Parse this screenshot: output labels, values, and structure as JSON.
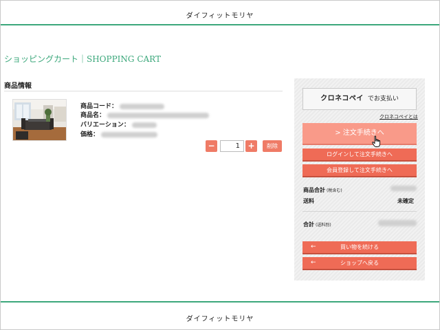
{
  "header": {
    "shop_name": "ダイフィットモリヤ"
  },
  "page_title": "ショッピングカート｜SHOPPING CART",
  "product_section": {
    "heading": "商品情報",
    "item": {
      "code_label": "商品コード：",
      "name_label": "商品名：",
      "variation_label": "バリエーション：",
      "price_label": "価格：",
      "quantity": "1",
      "minus_label": "−",
      "plus_label": "+",
      "delete_label": "削除"
    }
  },
  "sidebar": {
    "kuroneko_pay_brand": "クロネコペイ",
    "kuroneko_pay_suffix": "でお支払い",
    "kuroneko_link": "クロネコペイとは",
    "checkout_button": "> 注文手続きへ",
    "login_checkout_button": "ログインして注文手続きへ",
    "register_checkout_button": "会員登録して注文手続きへ",
    "subtotal_label": "商品合計",
    "subtotal_note": "(税含む)",
    "shipping_label": "送料",
    "shipping_value": "未確定",
    "total_label": "合計",
    "total_note": "(送料別)",
    "continue_shopping_button": "買い物を続ける",
    "back_to_shop_button": "ショップへ戻る",
    "arrow_glyph": "←"
  },
  "footer": {
    "shop_name": "ダイフィットモリヤ"
  },
  "colors": {
    "accent_green": "#3aa77a",
    "button_red": "#ef6b56",
    "button_light": "#f99a89"
  },
  "icons": {
    "cursor": "hand-pointer-icon",
    "arrow": "arrow-left-icon"
  }
}
